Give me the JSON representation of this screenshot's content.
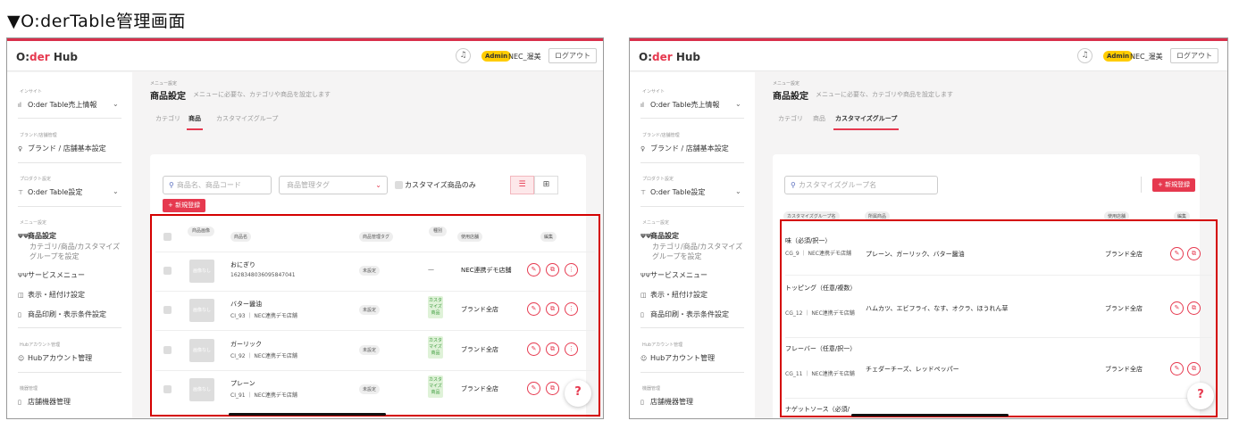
{
  "heading": "▼O:derTable管理画面",
  "app": {
    "logo_a": "O:",
    "logo_b": "der",
    "logo_c": " Hub",
    "admin_badge": "Admin",
    "user_name": "NEC_渥美",
    "logout": "ログアウト",
    "bell_icon": "bell-icon"
  },
  "sidebar": {
    "insight_section": "インサイト",
    "insight_item": "O:der Table売上情報",
    "brand_section": "ブランド/店舗管理",
    "brand_item": "ブランド / 店舗基本設定",
    "product_section": "プロダクト設定",
    "product_item": "O:der Table設定",
    "menu_section": "メニュー設定",
    "menu_item": "商品設定",
    "menu_sub": "カテゴリ/商品/カスタマイズグループを設定",
    "service_menu": "サービスメニュー",
    "display_setting": "表示・紐付け設定",
    "print_setting": "商品印刷・表示条件設定",
    "hub_section": "Hubアカウント管理",
    "hub_item": "Hubアカウント管理",
    "device_section": "機器管理",
    "device_item": "店舗機器管理"
  },
  "page": {
    "breadcrumb": "メニュー設定",
    "title": "商品設定",
    "description": "メニューに必要な、カテゴリや商品を設定します",
    "tabs": [
      "カテゴリ",
      "商品",
      "カスタマイズグループ"
    ]
  },
  "products": {
    "search_placeholder": "商品名、商品コード",
    "tag_placeholder": "商品管理タグ",
    "custom_only": "カスタマイズ商品のみ",
    "new_button": "+ 新規登録",
    "headers": [
      "商品画像",
      "商品名",
      "商品管理タグ",
      "種別",
      "使用店舗",
      "編集"
    ],
    "no_image": "画像なし",
    "rows": [
      {
        "name": "おにぎり",
        "code": "1628348036095847041",
        "store_code": "",
        "tag": "未設定",
        "type": "—",
        "store": "NEC連携デモ店舗"
      },
      {
        "name": "バター醤油",
        "code": "CI_93",
        "store_code": "NEC連携デモ店舗",
        "tag": "未設定",
        "type": "カスタマイズ商品",
        "store": "ブランド全店"
      },
      {
        "name": "ガーリック",
        "code": "CI_92",
        "store_code": "NEC連携デモ店舗",
        "tag": "未設定",
        "type": "カスタマイズ商品",
        "store": "ブランド全店"
      },
      {
        "name": "プレーン",
        "code": "CI_91",
        "store_code": "NEC連携デモ店舗",
        "tag": "未設定",
        "type": "カスタマイズ商品",
        "store": "ブランド全店"
      }
    ]
  },
  "groups": {
    "search_placeholder": "カスタマイズグループ名",
    "new_button": "+ 新規登録",
    "headers": [
      "カスタマイズグループ名",
      "所属商品",
      "使用店舗",
      "編集"
    ],
    "rows": [
      {
        "name": "味（必須/択一）",
        "code": "CG_9",
        "store_code": "NEC連携デモ店舗",
        "items": "プレーン、ガーリック、バター醤油",
        "store": "ブランド全店"
      },
      {
        "name": "トッピング（任意/複数）",
        "code": "CG_12",
        "store_code": "NEC連携デモ店舗",
        "items": "ハムカツ、エビフライ、なす、オクラ、ほうれん草",
        "store": "ブランド全店"
      },
      {
        "name": "フレーバー（任意/択一）",
        "code": "CG_11",
        "store_code": "NEC連携デモ店舗",
        "items": "チェダーチーズ、レッドペッパー",
        "store": "ブランド全店"
      },
      {
        "name": "ナゲットソース（必須/",
        "code": "",
        "store_code": "",
        "items": "",
        "store": ""
      }
    ]
  },
  "colors": {
    "accent": "#e6394f",
    "highlight": "#d40000",
    "admin": "#ffcc00"
  }
}
